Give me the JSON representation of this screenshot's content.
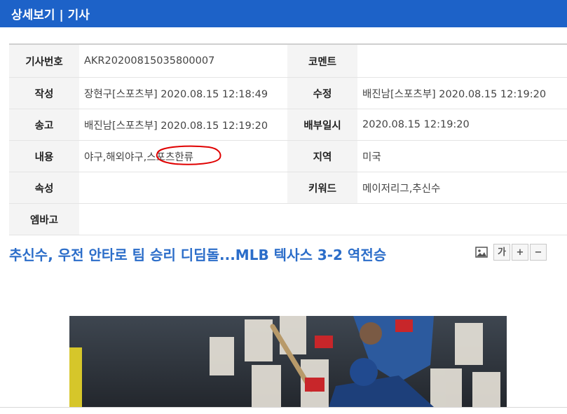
{
  "header": {
    "title": "상세보기 | 기사"
  },
  "meta": {
    "rows": [
      {
        "k1": "기사번호",
        "v1": "AKR20200815035800007",
        "k2": "코멘트",
        "v2": ""
      },
      {
        "k1": "작성",
        "v1": "장현구[스포츠부] 2020.08.15 12:18:49",
        "k2": "수정",
        "v2": "배진남[스포츠부] 2020.08.15 12:19:20"
      },
      {
        "k1": "송고",
        "v1": "배진남[스포츠부] 2020.08.15 12:19:20",
        "k2": "배부일시",
        "v2": "2020.08.15 12:19:20"
      },
      {
        "k1": "내용",
        "v1": "야구,해외야구,스포츠한류",
        "k2": "지역",
        "v2": "미국"
      },
      {
        "k1": "속성",
        "v1": "",
        "k2": "키워드",
        "v2": "메이저리그,추신수"
      },
      {
        "k1": "엠바고",
        "v1": ""
      }
    ]
  },
  "article": {
    "headline": "추신수, 우전 안타로 팀 승리 디딤돌...MLB 텍사스 3-2 역전승"
  },
  "tools": {
    "font_label": "가",
    "plus": "+",
    "minus": "−"
  },
  "colors": {
    "header_bg": "#1d62c8",
    "headline": "#2b6dc9",
    "annotation": "#e00000"
  }
}
